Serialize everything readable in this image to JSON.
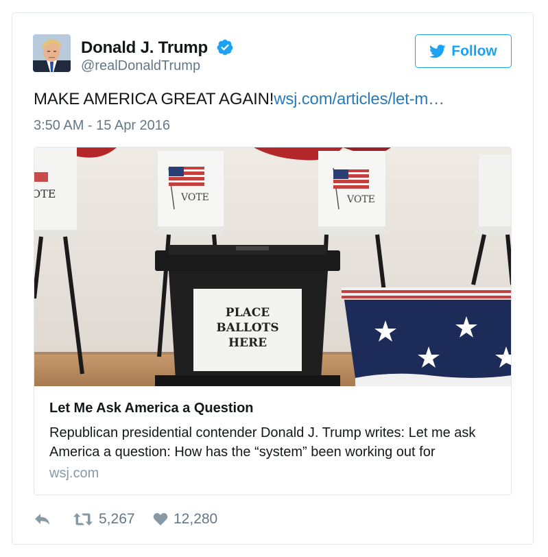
{
  "author": {
    "display_name": "Donald J. Trump",
    "screen_name": "@realDonaldTrump",
    "verified": true
  },
  "follow_button": {
    "label": "Follow",
    "icon": "twitter-bird-icon"
  },
  "tweet": {
    "text": "MAKE AMERICA GREAT AGAIN!",
    "link_text": "wsj.com/articles/let-m…",
    "timestamp": "3:50 AM - 15 Apr 2016"
  },
  "card": {
    "image_signs": {
      "left_booth": "OTE",
      "center_booth": "VOTE",
      "right_booth": "VOTE",
      "ballot_box": [
        "PLACE",
        "BALLOTS",
        "HERE"
      ]
    },
    "title": "Let Me Ask America a Question",
    "description": "Republican presidential contender Donald J. Trump writes: Let me ask America a question: How has the “system” been working out for",
    "domain": "wsj.com"
  },
  "actions": {
    "reply": {
      "icon": "reply-icon"
    },
    "retweet": {
      "icon": "retweet-icon",
      "count": "5,267"
    },
    "like": {
      "icon": "heart-icon",
      "count": "12,280"
    }
  },
  "colors": {
    "twitter_blue": "#1da1f2",
    "link_blue": "#2b7bb9",
    "secondary_gray": "#657786",
    "domain_gray": "#8899a6",
    "border": "#e1e8ed"
  }
}
